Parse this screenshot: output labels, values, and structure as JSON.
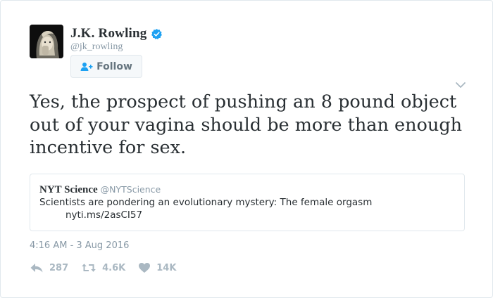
{
  "author": {
    "name": "J.K. Rowling",
    "handle": "@jk_rowling",
    "verified_icon": "verified-badge-icon",
    "avatar": "profile-photo"
  },
  "follow_button": {
    "label": "Follow",
    "icon": "add-user-icon"
  },
  "tweet": {
    "text": "Yes, the prospect of pushing an 8 pound object out of your vagina should be more than enough incentive for sex."
  },
  "quoted_tweet": {
    "name": "NYT Science",
    "handle": "@NYTScience",
    "text": "Scientists are pondering an evolutionary mystery: The female orgasm",
    "link": "nyti.ms/2asCI57"
  },
  "timestamp": "4:16 AM - 3 Aug 2016",
  "actions": {
    "reply": {
      "icon": "reply-icon",
      "count": "287"
    },
    "retweet": {
      "icon": "retweet-icon",
      "count": "4.6K"
    },
    "like": {
      "icon": "heart-icon",
      "count": "14K"
    }
  },
  "colors": {
    "accent": "#1da1f2",
    "muted": "#8899a6",
    "action_gray": "#aab8c2",
    "text": "#292f33",
    "border": "#e1e8ed"
  }
}
